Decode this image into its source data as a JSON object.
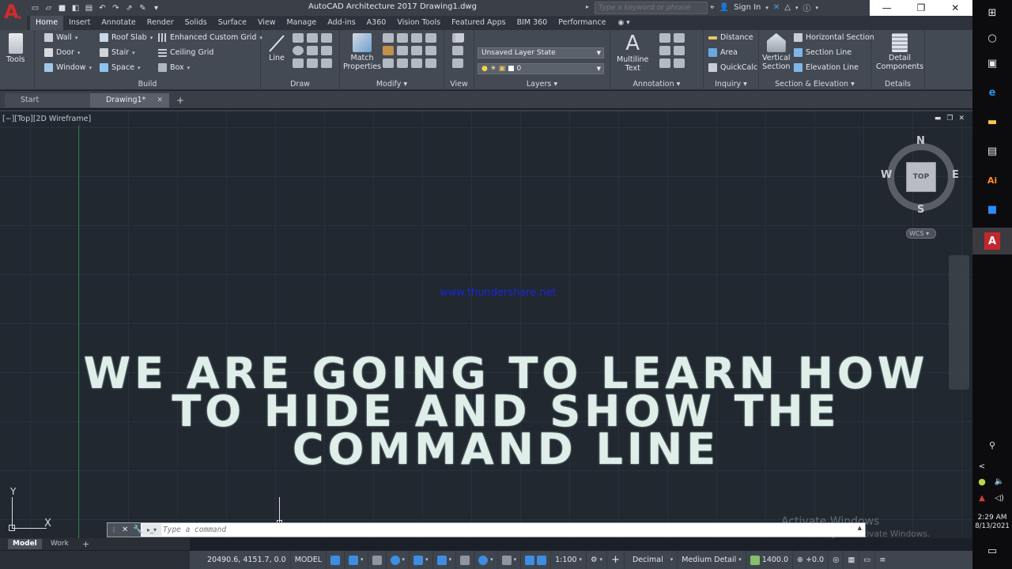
{
  "titlebar": {
    "title": "AutoCAD Architecture 2017    Drawing1.dwg",
    "search_placeholder": "Type a keyword or phrase",
    "sign_in": "Sign In"
  },
  "ribbon_tabs": [
    "Home",
    "Insert",
    "Annotate",
    "Render",
    "Solids",
    "Surface",
    "View",
    "Manage",
    "Add-ins",
    "A360",
    "Vision Tools",
    "Featured Apps",
    "BIM 360",
    "Performance"
  ],
  "ribbon": {
    "tools_label": "Tools",
    "build": {
      "title": "Build",
      "wall": "Wall",
      "door": "Door",
      "window": "Window",
      "roof_slab": "Roof Slab",
      "stair": "Stair",
      "space": "Space",
      "enhanced_custom_grid": "Enhanced Custom Grid",
      "ceiling_grid": "Ceiling Grid",
      "box": "Box"
    },
    "draw": {
      "title": "Draw",
      "line": "Line"
    },
    "modify": {
      "title": "Modify",
      "match_properties": "Match\nProperties"
    },
    "view": {
      "title": "View"
    },
    "layers": {
      "title": "Layers",
      "layer_state": "Unsaved Layer State",
      "current_layer": "0"
    },
    "annotation": {
      "title": "Annotation",
      "multiline_text": "Multiline\nText"
    },
    "inquiry": {
      "title": "Inquiry",
      "distance": "Distance",
      "area": "Area",
      "quickcalc": "QuickCalc"
    },
    "section": {
      "title": "Section & Elevation",
      "vertical_section": "Vertical\nSection",
      "horizontal_section": "Horizontal Section",
      "section_line": "Section Line",
      "elevation_line": "Elevation Line"
    },
    "details": {
      "title": "Details",
      "detail_components": "Detail\nComponents"
    }
  },
  "file_tabs": {
    "start": "Start",
    "drawing": "Drawing1*"
  },
  "drawing": {
    "viewport_label": "[−][Top][2D Wireframe]",
    "watermark_url": "www.thundershare.net",
    "viewcube": {
      "north": "N",
      "south": "S",
      "east": "E",
      "west": "W",
      "top": "TOP",
      "wcs": "WCS"
    },
    "overlay_lines": [
      "WE ARE GOING TO LEARN HOW",
      "TO HIDE AND SHOW THE",
      "COMMAND LINE"
    ],
    "ucs": {
      "x": "X",
      "y": "Y"
    },
    "activate_title": "Activate Windows",
    "activate_sub": "Go to Settings to activate Windows."
  },
  "command_line": {
    "placeholder": "Type a command"
  },
  "layout_tabs": {
    "model": "Model",
    "work": "Work"
  },
  "status_bar": {
    "coords": "20490.6, 4151.7, 0.0",
    "model": "MODEL",
    "scale": "1:100",
    "units": "Decimal",
    "detail": "Medium Detail",
    "elevation": "1400.0",
    "offset": "+0.0"
  },
  "taskbar": {
    "time": "2:29 AM",
    "date": "8/13/2021"
  }
}
